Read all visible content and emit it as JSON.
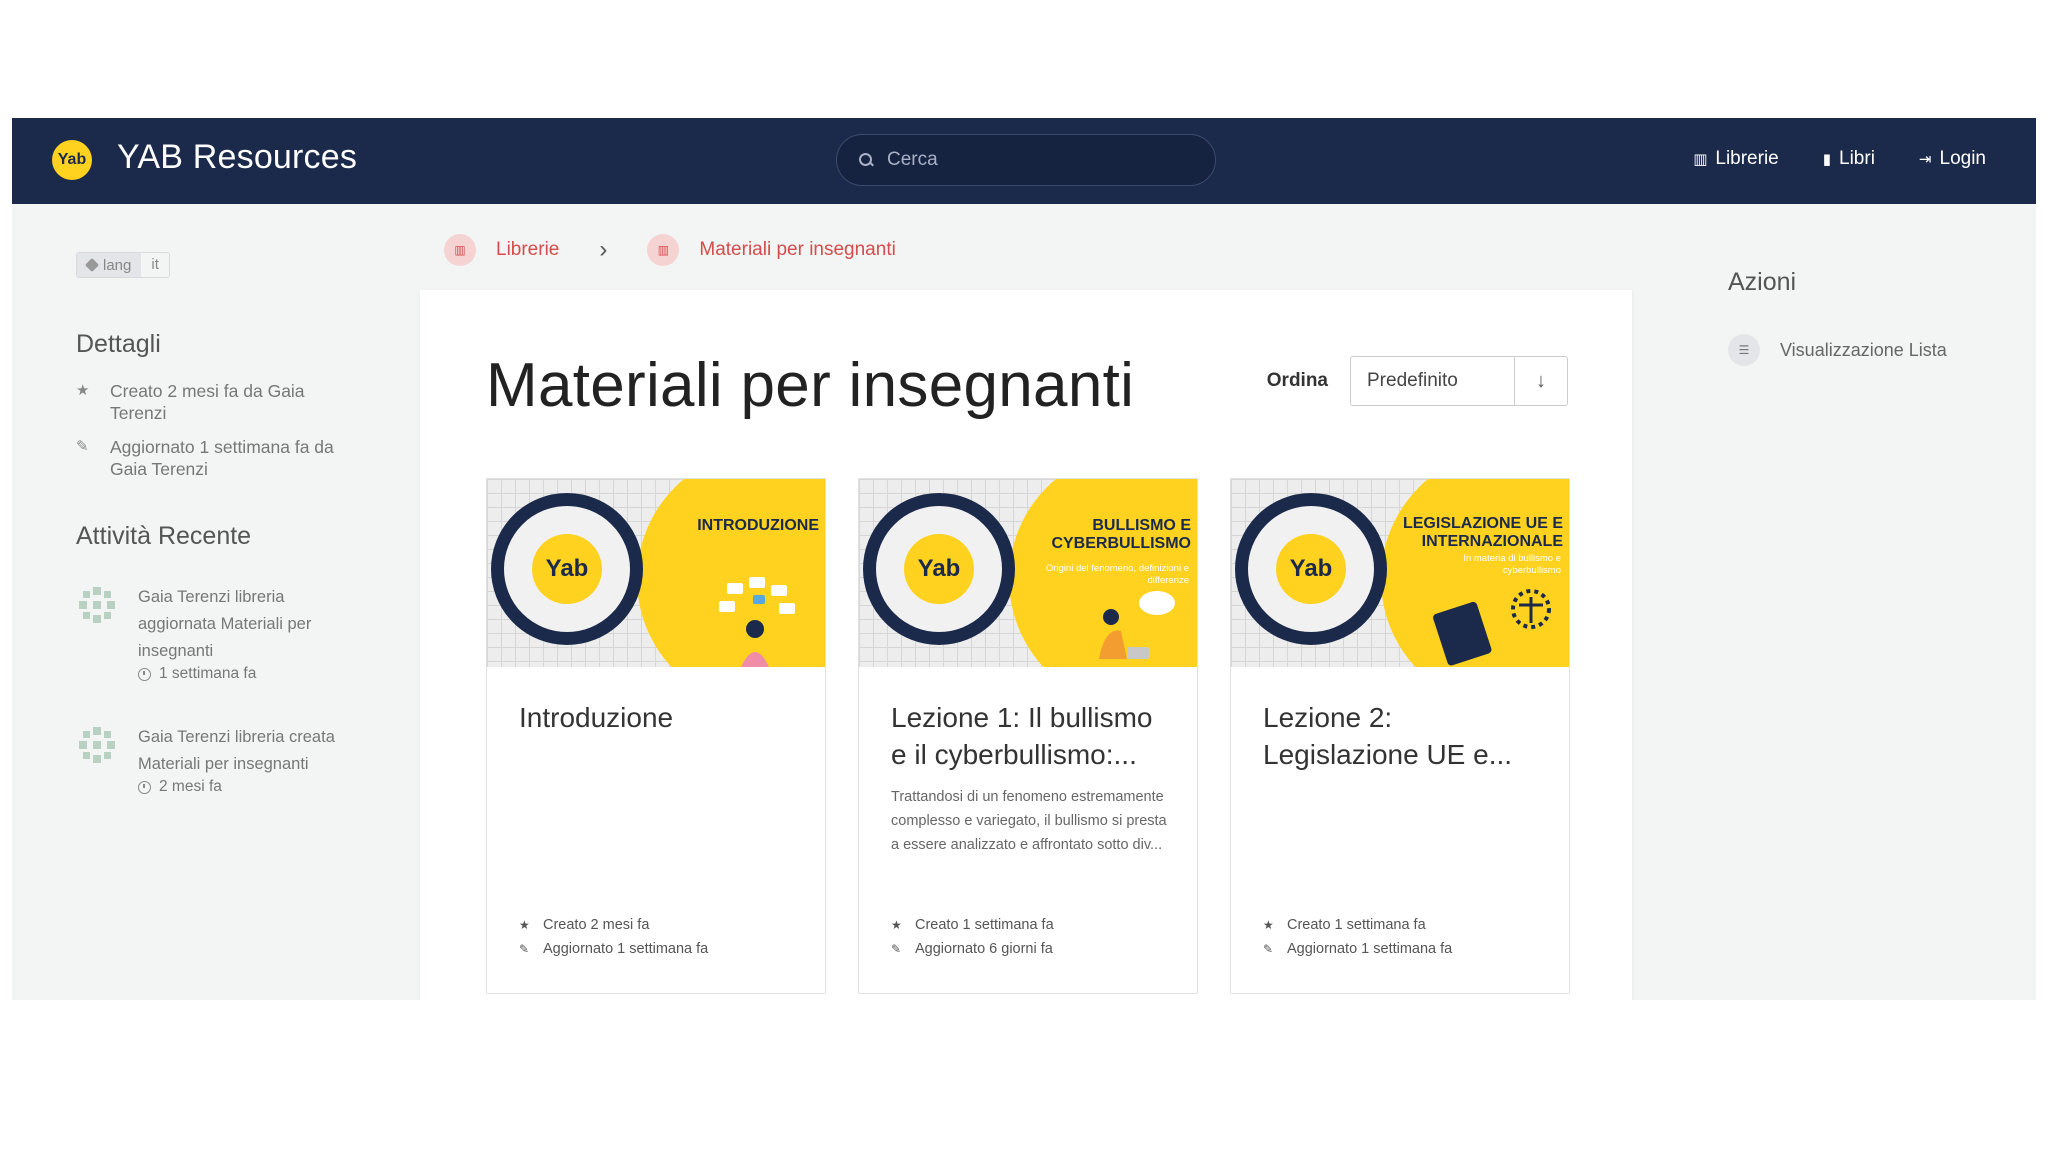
{
  "header": {
    "title": "YAB Resources",
    "logo_text": "Yab",
    "search_placeholder": "Cerca",
    "nav": [
      {
        "label": "Librerie",
        "icon": "libraries-icon"
      },
      {
        "label": "Libri",
        "icon": "books-icon"
      },
      {
        "label": "Login",
        "icon": "login-icon"
      }
    ]
  },
  "tags": [
    {
      "key": "lang",
      "value": "it"
    }
  ],
  "details": {
    "heading": "Dettagli",
    "created": "Creato 2 mesi fa da Gaia Terenzi",
    "updated": "Aggiornato 1 settimana fa da Gaia Terenzi"
  },
  "activity": {
    "heading": "Attività Recente",
    "items": [
      {
        "text": "Gaia Terenzi libreria aggiornata Materiali per insegnanti",
        "time": "1 settimana fa"
      },
      {
        "text": "Gaia Terenzi libreria creata Materiali per insegnanti",
        "time": "2 mesi fa"
      }
    ]
  },
  "breadcrumb": [
    {
      "label": "Librerie"
    },
    {
      "label": "Materiali per insegnanti"
    }
  ],
  "main": {
    "title": "Materiali per insegnanti",
    "sort_label": "Ordina",
    "sort_value": "Predefinito",
    "sort_dir": "↓"
  },
  "books": [
    {
      "title": "Introduzione",
      "cover_title": "INTRODUZIONE",
      "cover_sub": "",
      "description": "",
      "created": "Creato 2 mesi fa",
      "updated": "Aggiornato 1 settimana fa"
    },
    {
      "title": "Lezione 1: Il bullismo e il cyberbullismo:...",
      "cover_title": "BULLISMO E CYBERBULLISMO",
      "cover_sub": "Origini del fenomeno, definizioni e differenze",
      "description": "Trattandosi di un fenomeno estremamente complesso e variegato, il bullismo si presta a essere analizzato e affrontato sotto div...",
      "created": "Creato 1 settimana fa",
      "updated": "Aggiornato 6 giorni fa"
    },
    {
      "title": "Lezione 2: Legislazione UE e...",
      "cover_title": "LEGISLAZIONE UE E INTERNAZIONALE",
      "cover_sub": "In materia di bullismo e cyberbullismo",
      "description": "",
      "created": "Creato 1 settimana fa",
      "updated": "Aggiornato 1 settimana fa"
    }
  ],
  "actions": {
    "heading": "Azioni",
    "list_view": "Visualizzazione Lista"
  },
  "colors": {
    "header_bg": "#1b2a4a",
    "accent_yellow": "#ffd21f",
    "link_red": "#d44c4c"
  }
}
